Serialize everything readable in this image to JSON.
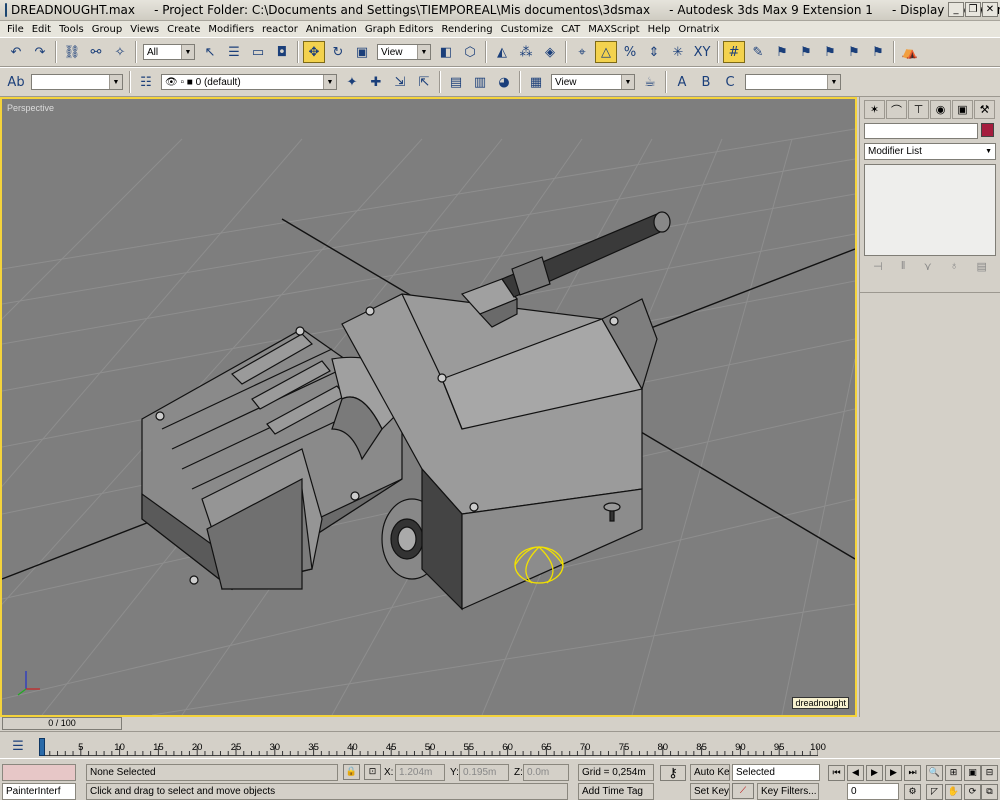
{
  "window": {
    "title": "DREADNOUGHT.max     - Project Folder: C:\\Documents and Settings\\TIEMPOREAL\\Mis documentos\\3dsmax     - Autodesk 3ds Max 9 Extension 1     - Display : Software",
    "minimize": "_",
    "restore": "❐",
    "close": "✕"
  },
  "menu": [
    "File",
    "Edit",
    "Tools",
    "Group",
    "Views",
    "Create",
    "Modifiers",
    "reactor",
    "Animation",
    "Graph Editors",
    "Rendering",
    "Customize",
    "CAT",
    "MAXScript",
    "Help",
    "Ornatrix"
  ],
  "toolbar1": {
    "selection_filter": "All",
    "ref_coord": "View"
  },
  "toolbar2": {
    "layer": "0 (default)",
    "view_dropdown": "View",
    "named_sel": ""
  },
  "viewport": {
    "label": "Perspective",
    "object_tag": "dreadnought"
  },
  "command_panel": {
    "modifier_list": "Modifier List"
  },
  "time": {
    "slider": "0 / 100",
    "ticks": [
      "0",
      "5",
      "10",
      "15",
      "20",
      "25",
      "30",
      "35",
      "40",
      "45",
      "50",
      "55",
      "60",
      "65",
      "70",
      "75",
      "80",
      "85",
      "90",
      "95",
      "100"
    ]
  },
  "status": {
    "maxscript_line": "",
    "maxscript_listener": "PainterInterf",
    "selection": "None Selected",
    "prompt": "Click and drag to select and move objects",
    "x_label": "X:",
    "x_value": "1.204m",
    "y_label": "Y:",
    "y_value": "0.195m",
    "z_label": "Z:",
    "z_value": "0.0m",
    "grid": "Grid = 0,254m",
    "add_time_tag": "Add Time Tag",
    "auto_key": "Auto Key",
    "set_key": "Set Key",
    "key_mode": "Selected",
    "key_filters": "Key Filters...",
    "frame": "0"
  },
  "colors": {
    "viewport_bg": "#7e7e7e",
    "active_border": "#f4d33b",
    "object_color": "#a51d3e"
  }
}
